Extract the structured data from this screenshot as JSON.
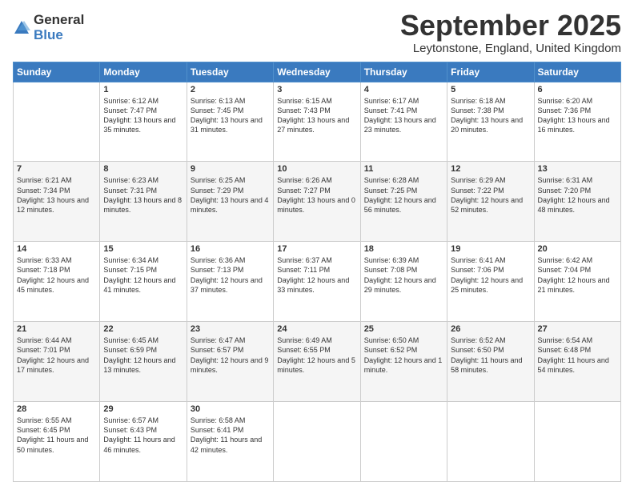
{
  "logo": {
    "general": "General",
    "blue": "Blue"
  },
  "header": {
    "month": "September 2025",
    "location": "Leytonstone, England, United Kingdom"
  },
  "weekdays": [
    "Sunday",
    "Monday",
    "Tuesday",
    "Wednesday",
    "Thursday",
    "Friday",
    "Saturday"
  ],
  "weeks": [
    [
      {
        "day": "",
        "sunrise": "",
        "sunset": "",
        "daylight": ""
      },
      {
        "day": "1",
        "sunrise": "Sunrise: 6:12 AM",
        "sunset": "Sunset: 7:47 PM",
        "daylight": "Daylight: 13 hours and 35 minutes."
      },
      {
        "day": "2",
        "sunrise": "Sunrise: 6:13 AM",
        "sunset": "Sunset: 7:45 PM",
        "daylight": "Daylight: 13 hours and 31 minutes."
      },
      {
        "day": "3",
        "sunrise": "Sunrise: 6:15 AM",
        "sunset": "Sunset: 7:43 PM",
        "daylight": "Daylight: 13 hours and 27 minutes."
      },
      {
        "day": "4",
        "sunrise": "Sunrise: 6:17 AM",
        "sunset": "Sunset: 7:41 PM",
        "daylight": "Daylight: 13 hours and 23 minutes."
      },
      {
        "day": "5",
        "sunrise": "Sunrise: 6:18 AM",
        "sunset": "Sunset: 7:38 PM",
        "daylight": "Daylight: 13 hours and 20 minutes."
      },
      {
        "day": "6",
        "sunrise": "Sunrise: 6:20 AM",
        "sunset": "Sunset: 7:36 PM",
        "daylight": "Daylight: 13 hours and 16 minutes."
      }
    ],
    [
      {
        "day": "7",
        "sunrise": "Sunrise: 6:21 AM",
        "sunset": "Sunset: 7:34 PM",
        "daylight": "Daylight: 13 hours and 12 minutes."
      },
      {
        "day": "8",
        "sunrise": "Sunrise: 6:23 AM",
        "sunset": "Sunset: 7:31 PM",
        "daylight": "Daylight: 13 hours and 8 minutes."
      },
      {
        "day": "9",
        "sunrise": "Sunrise: 6:25 AM",
        "sunset": "Sunset: 7:29 PM",
        "daylight": "Daylight: 13 hours and 4 minutes."
      },
      {
        "day": "10",
        "sunrise": "Sunrise: 6:26 AM",
        "sunset": "Sunset: 7:27 PM",
        "daylight": "Daylight: 13 hours and 0 minutes."
      },
      {
        "day": "11",
        "sunrise": "Sunrise: 6:28 AM",
        "sunset": "Sunset: 7:25 PM",
        "daylight": "Daylight: 12 hours and 56 minutes."
      },
      {
        "day": "12",
        "sunrise": "Sunrise: 6:29 AM",
        "sunset": "Sunset: 7:22 PM",
        "daylight": "Daylight: 12 hours and 52 minutes."
      },
      {
        "day": "13",
        "sunrise": "Sunrise: 6:31 AM",
        "sunset": "Sunset: 7:20 PM",
        "daylight": "Daylight: 12 hours and 48 minutes."
      }
    ],
    [
      {
        "day": "14",
        "sunrise": "Sunrise: 6:33 AM",
        "sunset": "Sunset: 7:18 PM",
        "daylight": "Daylight: 12 hours and 45 minutes."
      },
      {
        "day": "15",
        "sunrise": "Sunrise: 6:34 AM",
        "sunset": "Sunset: 7:15 PM",
        "daylight": "Daylight: 12 hours and 41 minutes."
      },
      {
        "day": "16",
        "sunrise": "Sunrise: 6:36 AM",
        "sunset": "Sunset: 7:13 PM",
        "daylight": "Daylight: 12 hours and 37 minutes."
      },
      {
        "day": "17",
        "sunrise": "Sunrise: 6:37 AM",
        "sunset": "Sunset: 7:11 PM",
        "daylight": "Daylight: 12 hours and 33 minutes."
      },
      {
        "day": "18",
        "sunrise": "Sunrise: 6:39 AM",
        "sunset": "Sunset: 7:08 PM",
        "daylight": "Daylight: 12 hours and 29 minutes."
      },
      {
        "day": "19",
        "sunrise": "Sunrise: 6:41 AM",
        "sunset": "Sunset: 7:06 PM",
        "daylight": "Daylight: 12 hours and 25 minutes."
      },
      {
        "day": "20",
        "sunrise": "Sunrise: 6:42 AM",
        "sunset": "Sunset: 7:04 PM",
        "daylight": "Daylight: 12 hours and 21 minutes."
      }
    ],
    [
      {
        "day": "21",
        "sunrise": "Sunrise: 6:44 AM",
        "sunset": "Sunset: 7:01 PM",
        "daylight": "Daylight: 12 hours and 17 minutes."
      },
      {
        "day": "22",
        "sunrise": "Sunrise: 6:45 AM",
        "sunset": "Sunset: 6:59 PM",
        "daylight": "Daylight: 12 hours and 13 minutes."
      },
      {
        "day": "23",
        "sunrise": "Sunrise: 6:47 AM",
        "sunset": "Sunset: 6:57 PM",
        "daylight": "Daylight: 12 hours and 9 minutes."
      },
      {
        "day": "24",
        "sunrise": "Sunrise: 6:49 AM",
        "sunset": "Sunset: 6:55 PM",
        "daylight": "Daylight: 12 hours and 5 minutes."
      },
      {
        "day": "25",
        "sunrise": "Sunrise: 6:50 AM",
        "sunset": "Sunset: 6:52 PM",
        "daylight": "Daylight: 12 hours and 1 minute."
      },
      {
        "day": "26",
        "sunrise": "Sunrise: 6:52 AM",
        "sunset": "Sunset: 6:50 PM",
        "daylight": "Daylight: 11 hours and 58 minutes."
      },
      {
        "day": "27",
        "sunrise": "Sunrise: 6:54 AM",
        "sunset": "Sunset: 6:48 PM",
        "daylight": "Daylight: 11 hours and 54 minutes."
      }
    ],
    [
      {
        "day": "28",
        "sunrise": "Sunrise: 6:55 AM",
        "sunset": "Sunset: 6:45 PM",
        "daylight": "Daylight: 11 hours and 50 minutes."
      },
      {
        "day": "29",
        "sunrise": "Sunrise: 6:57 AM",
        "sunset": "Sunset: 6:43 PM",
        "daylight": "Daylight: 11 hours and 46 minutes."
      },
      {
        "day": "30",
        "sunrise": "Sunrise: 6:58 AM",
        "sunset": "Sunset: 6:41 PM",
        "daylight": "Daylight: 11 hours and 42 minutes."
      },
      {
        "day": "",
        "sunrise": "",
        "sunset": "",
        "daylight": ""
      },
      {
        "day": "",
        "sunrise": "",
        "sunset": "",
        "daylight": ""
      },
      {
        "day": "",
        "sunrise": "",
        "sunset": "",
        "daylight": ""
      },
      {
        "day": "",
        "sunrise": "",
        "sunset": "",
        "daylight": ""
      }
    ]
  ]
}
